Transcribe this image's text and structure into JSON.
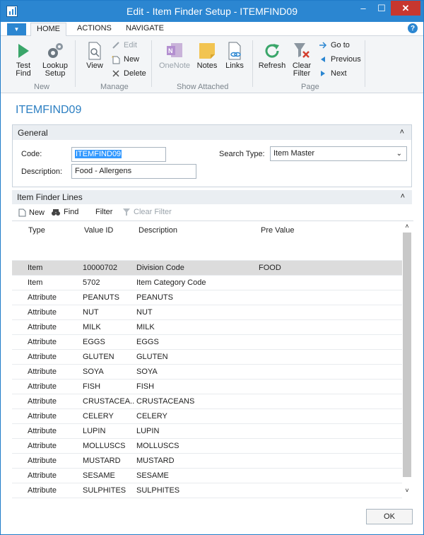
{
  "window": {
    "title": "Edit - Item Finder Setup - ITEMFIND09",
    "minimize": "–",
    "maximize": "☐",
    "close": "✕"
  },
  "ribbon_tabs": [
    "HOME",
    "ACTIONS",
    "NAVIGATE"
  ],
  "help": "?",
  "ribbon": {
    "new_group": {
      "test_find": "Test\nFind",
      "lookup_setup": "Lookup\nSetup",
      "label": "New"
    },
    "manage_group": {
      "view": "View",
      "edit": "Edit",
      "new": "New",
      "delete": "Delete",
      "label": "Manage"
    },
    "show_attached_group": {
      "onenote": "OneNote",
      "notes": "Notes",
      "links": "Links",
      "label": "Show Attached"
    },
    "page_group": {
      "refresh": "Refresh",
      "clear_filter": "Clear\nFilter",
      "go_to": "Go to",
      "previous": "Previous",
      "next": "Next",
      "label": "Page"
    }
  },
  "page_title": "ITEMFIND09",
  "general": {
    "header": "General",
    "code_label": "Code:",
    "code_value": "ITEMFIND09",
    "description_label": "Description:",
    "description_value": "Food - Allergens",
    "search_type_label": "Search Type:",
    "search_type_value": "Item Master"
  },
  "lines": {
    "header": "Item Finder Lines",
    "toolbar": {
      "new": "New",
      "find": "Find",
      "filter": "Filter",
      "clear_filter": "Clear Filter"
    },
    "columns": [
      "Type",
      "Value ID",
      "Description",
      "Pre Value"
    ],
    "rows": [
      {
        "type": "",
        "value_id": "",
        "description": "",
        "pre_value": ""
      },
      {
        "type": "Item",
        "value_id": "10000702",
        "description": "Division Code",
        "pre_value": "FOOD"
      },
      {
        "type": "Item",
        "value_id": "5702",
        "description": "Item Category Code",
        "pre_value": ""
      },
      {
        "type": "Attribute",
        "value_id": "PEANUTS",
        "description": "PEANUTS",
        "pre_value": ""
      },
      {
        "type": "Attribute",
        "value_id": "NUT",
        "description": "NUT",
        "pre_value": ""
      },
      {
        "type": "Attribute",
        "value_id": "MILK",
        "description": "MILK",
        "pre_value": ""
      },
      {
        "type": "Attribute",
        "value_id": "EGGS",
        "description": "EGGS",
        "pre_value": ""
      },
      {
        "type": "Attribute",
        "value_id": "GLUTEN",
        "description": "GLUTEN",
        "pre_value": ""
      },
      {
        "type": "Attribute",
        "value_id": "SOYA",
        "description": "SOYA",
        "pre_value": ""
      },
      {
        "type": "Attribute",
        "value_id": "FISH",
        "description": "FISH",
        "pre_value": ""
      },
      {
        "type": "Attribute",
        "value_id": "CRUSTACEA...",
        "description": "CRUSTACEANS",
        "pre_value": ""
      },
      {
        "type": "Attribute",
        "value_id": "CELERY",
        "description": "CELERY",
        "pre_value": ""
      },
      {
        "type": "Attribute",
        "value_id": "LUPIN",
        "description": "LUPIN",
        "pre_value": ""
      },
      {
        "type": "Attribute",
        "value_id": "MOLLUSCS",
        "description": "MOLLUSCS",
        "pre_value": ""
      },
      {
        "type": "Attribute",
        "value_id": "MUSTARD",
        "description": "MUSTARD",
        "pre_value": ""
      },
      {
        "type": "Attribute",
        "value_id": "SESAME",
        "description": "SESAME",
        "pre_value": ""
      },
      {
        "type": "Attribute",
        "value_id": "SULPHITES",
        "description": "SULPHITES",
        "pre_value": ""
      }
    ],
    "selected_row": 1
  },
  "ok_button": "OK",
  "colors": {
    "accent": "#2b86d1",
    "title_text": "#2c7fc2",
    "close": "#c7372f",
    "selected_row": "#dcdcdc"
  }
}
